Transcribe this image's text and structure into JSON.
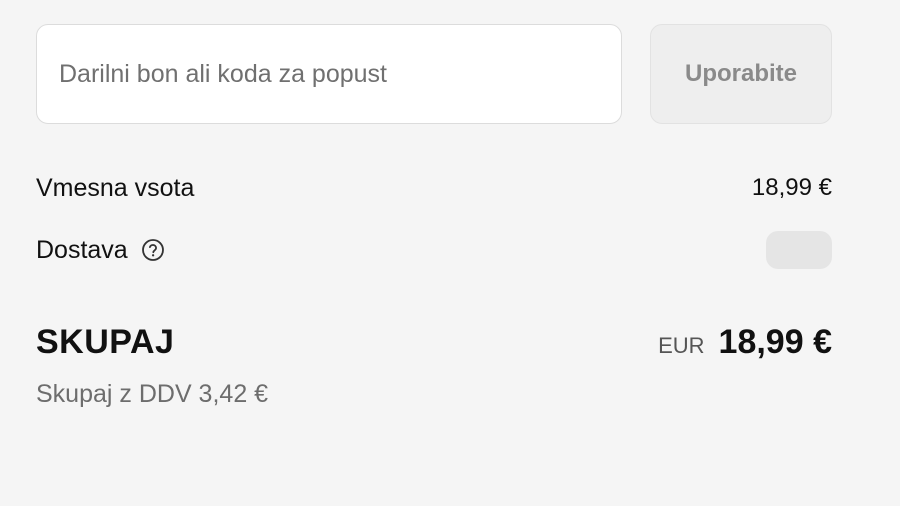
{
  "discount": {
    "placeholder": "Darilni bon ali koda za popust",
    "value": "",
    "apply_label": "Uporabite"
  },
  "summary": {
    "subtotal_label": "Vmesna vsota",
    "subtotal_value": "18,99 €",
    "shipping_label": "Dostava",
    "shipping_help_icon": "question-circle-icon",
    "total_label": "SKUPAJ",
    "currency_code": "EUR",
    "total_value": "18,99 €",
    "tax_note": "Skupaj z DDV 3,42 €"
  },
  "colors": {
    "background": "#f5f5f5",
    "input_background": "#ffffff",
    "button_background": "#eeeeee",
    "button_text": "#8a8a8a",
    "muted_text": "#6d6d6d"
  }
}
